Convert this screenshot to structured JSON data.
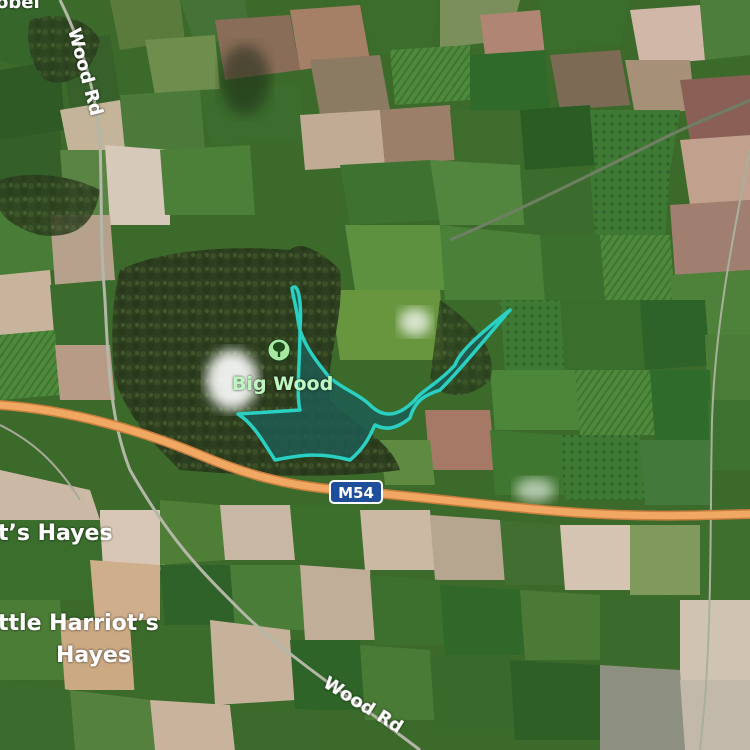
{
  "map": {
    "view": "satellite",
    "colors": {
      "highway": "#f0a862",
      "area_outline": "#2ad0c2",
      "area_fill": "#1f5c52",
      "poi_icon": "#a7e9a3",
      "label_text": "#ffffff"
    },
    "labels": {
      "place_top_left": "obel",
      "road_wood_rd_top": "Wood Rd",
      "road_wood_rd_bottom": "Wood Rd",
      "area_name": "Big Wood",
      "highway_shield": "M54",
      "place_hayes": "t’s Hayes",
      "place_little_line1": "ttle Harriot’s",
      "place_little_line2": "Hayes"
    },
    "icons": {
      "poi": "tree-icon"
    }
  }
}
